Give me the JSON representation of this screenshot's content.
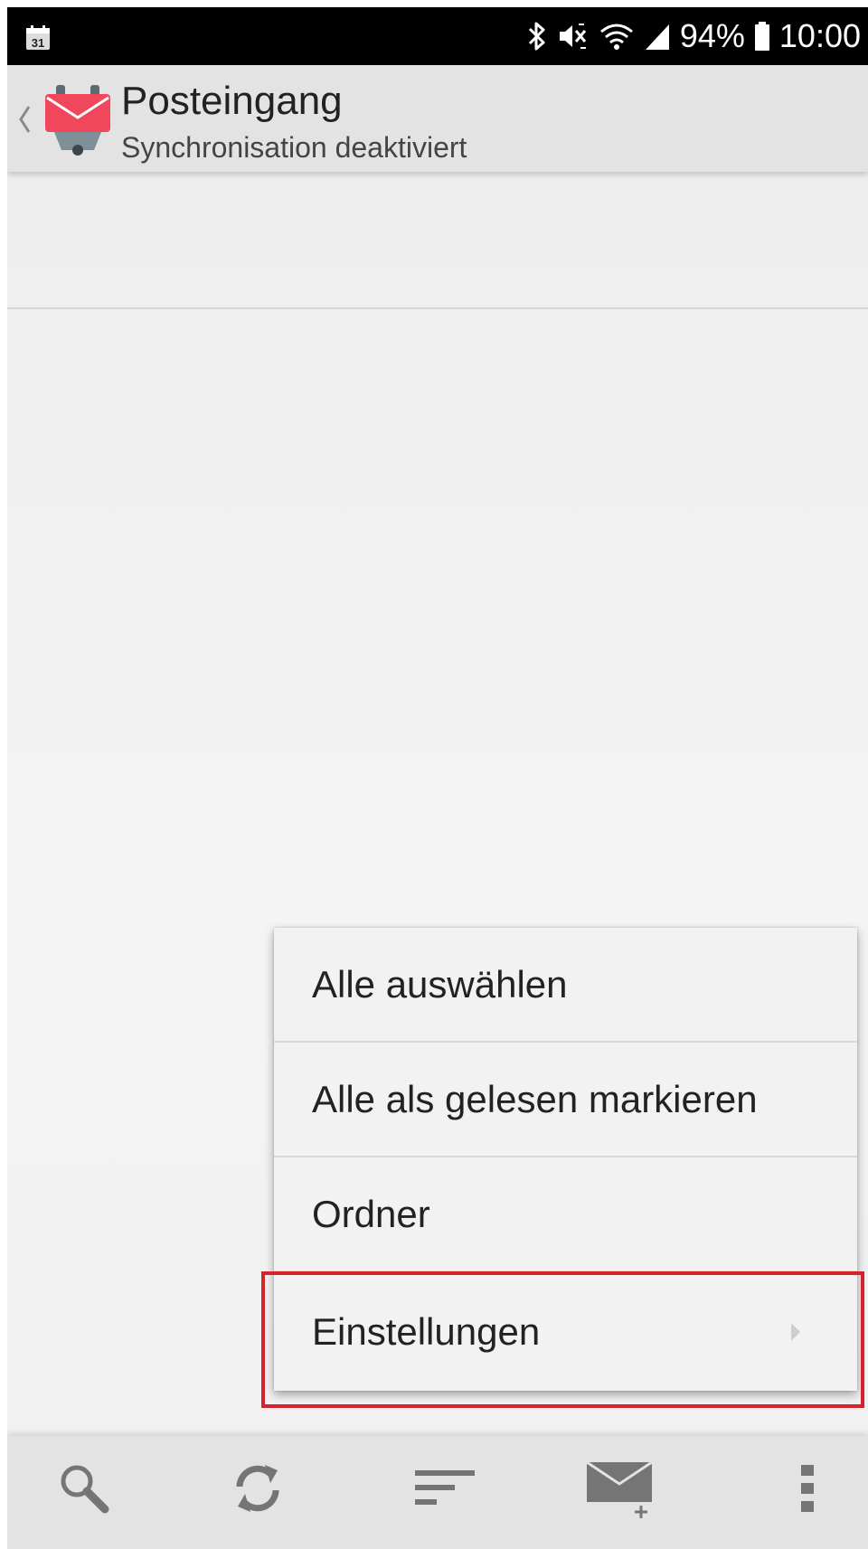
{
  "status_bar": {
    "calendar_date": "31",
    "battery_percent": "94%",
    "time": "10:00",
    "icons": [
      "calendar-icon",
      "bluetooth-icon",
      "mute-icon",
      "wifi-icon",
      "signal-icon",
      "battery-icon"
    ]
  },
  "action_bar": {
    "title": "Posteingang",
    "subtitle": "Synchronisation deaktiviert",
    "icons": [
      "back-chevron-icon",
      "k9-mail-app-icon"
    ]
  },
  "popup_menu": {
    "items": [
      {
        "label": "Alle auswählen",
        "has_submenu": false
      },
      {
        "label": "Alle als gelesen markieren",
        "has_submenu": false
      },
      {
        "label": "Ordner",
        "has_submenu": false
      },
      {
        "label": "Einstellungen",
        "has_submenu": true,
        "highlighted": true
      }
    ]
  },
  "bottom_bar": {
    "icons": [
      "search-icon",
      "refresh-icon",
      "sort-icon",
      "compose-mail-icon",
      "overflow-menu-icon"
    ]
  },
  "colors": {
    "app_red": "#f0475c",
    "highlight": "#d3242b",
    "bar_gray": "#e3e3e3",
    "icon_gray": "#757575"
  }
}
